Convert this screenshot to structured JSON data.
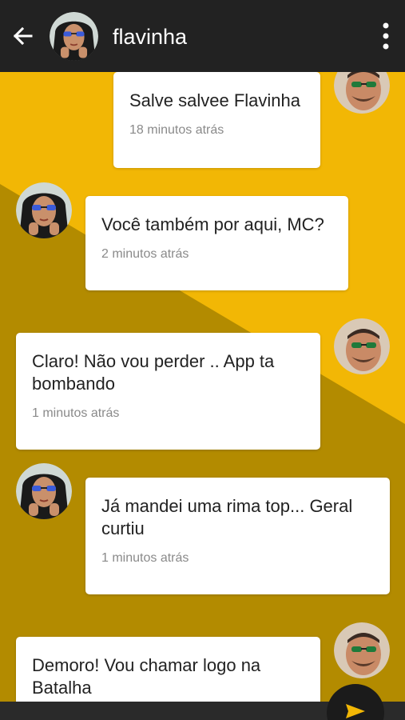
{
  "header": {
    "contact_name": "flavinha",
    "back_icon": "arrow-left-icon",
    "menu_icon": "more-vertical-icon"
  },
  "colors": {
    "app_bar": "#222222",
    "background_light": "#f2b705",
    "background_dark": "#b38b00",
    "bubble": "#ffffff",
    "send_button": "#1b1b1b",
    "send_icon": "#f2b705"
  },
  "messages": [
    {
      "sender": "me",
      "text": "Salve salvee Flavinha",
      "time": "18 minutos atrás"
    },
    {
      "sender": "flavinha",
      "text": "Você também por aqui, MC?",
      "time": "2 minutos atrás"
    },
    {
      "sender": "me",
      "text": "Claro! Não vou perder .. App ta bombando",
      "time": "1 minutos atrás"
    },
    {
      "sender": "flavinha",
      "text": "Já mandei uma rima top... Geral curtiu",
      "time": "1 minutos atrás"
    },
    {
      "sender": "me",
      "text": "Demoro! Vou chamar logo na Batalha",
      "time": ""
    }
  ],
  "composer": {
    "send_icon": "send-icon"
  }
}
